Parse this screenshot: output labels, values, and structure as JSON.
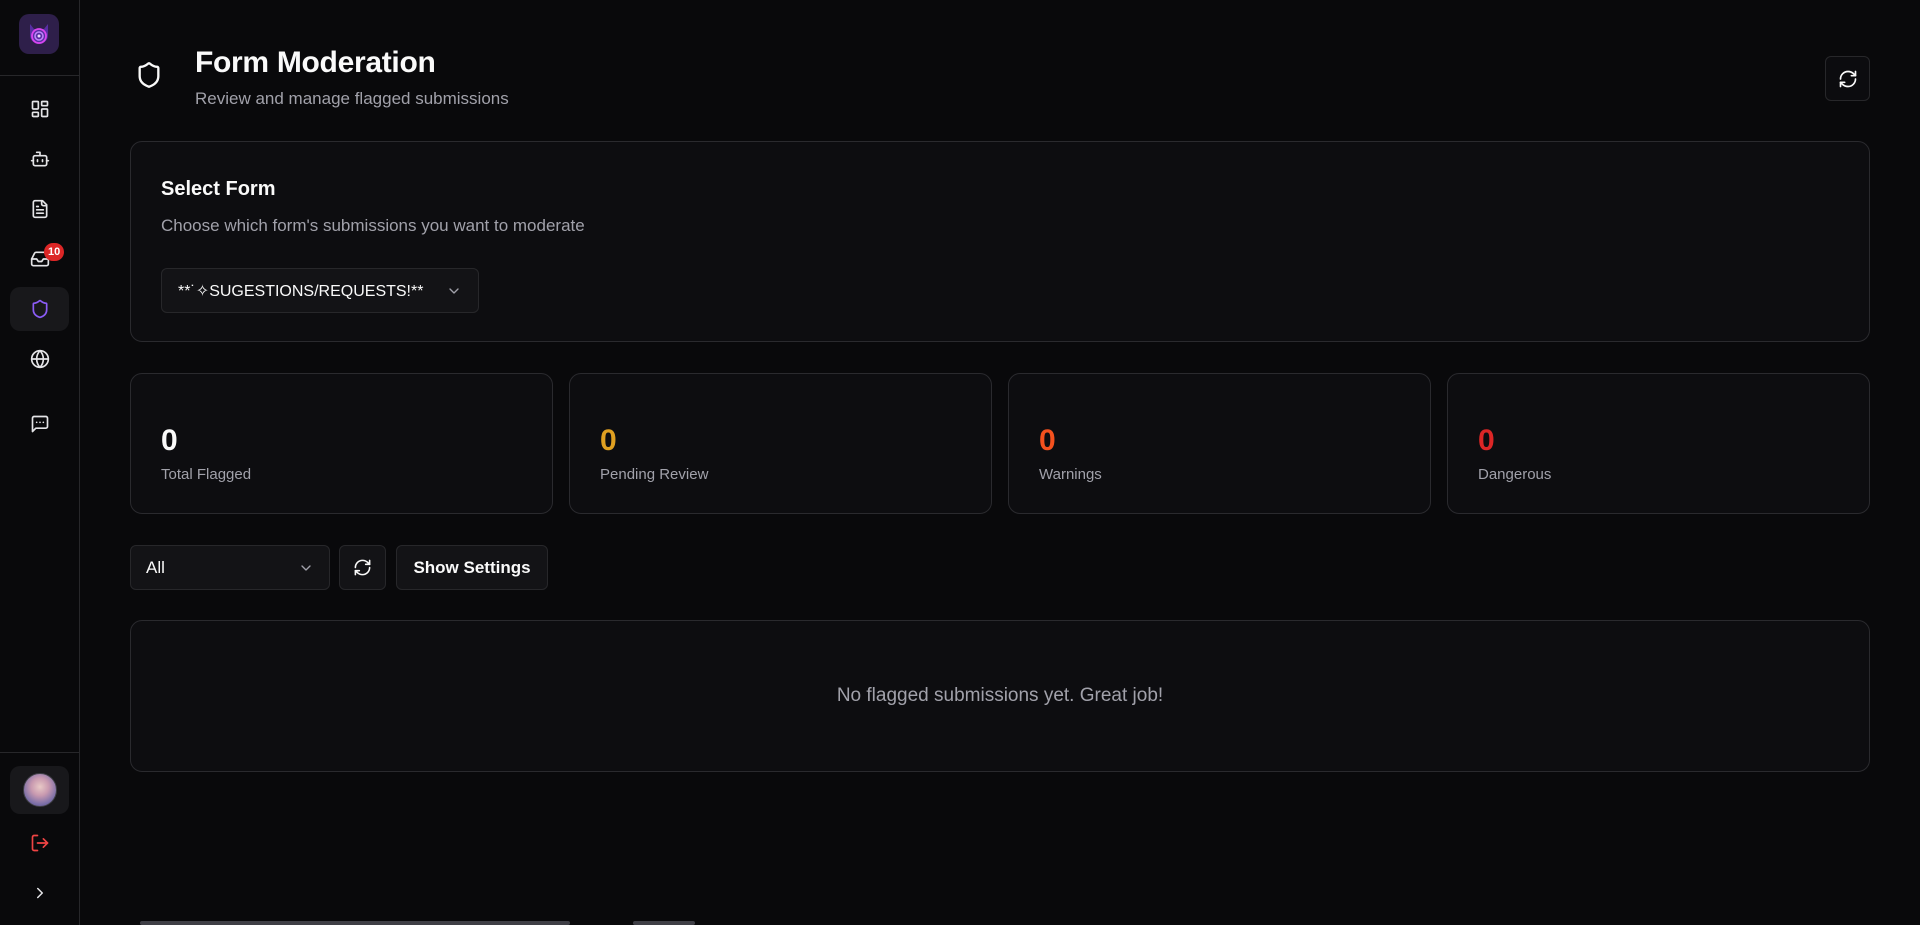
{
  "sidebar": {
    "logo": "cat-spiral-logo",
    "nav_items": [
      {
        "name": "dashboard",
        "icon": "grid-icon"
      },
      {
        "name": "bot",
        "icon": "bot-icon"
      },
      {
        "name": "forms",
        "icon": "document-icon"
      },
      {
        "name": "inbox",
        "icon": "inbox-icon",
        "badge": "10"
      },
      {
        "name": "moderation",
        "icon": "shield-icon",
        "active": true
      },
      {
        "name": "web",
        "icon": "globe-icon"
      },
      {
        "name": "messages",
        "icon": "message-icon"
      }
    ],
    "inbox_badge": "10"
  },
  "header": {
    "title": "Form Moderation",
    "subtitle": "Review and manage flagged submissions"
  },
  "select_form": {
    "title": "Select Form",
    "description": "Choose which form's submissions you want to moderate",
    "selected": "**˙✧SUGESTIONS/REQUESTS!**"
  },
  "stats": [
    {
      "value": "0",
      "label": "Total Flagged",
      "color": "#fafafa"
    },
    {
      "value": "0",
      "label": "Pending Review",
      "color": "#e0a021"
    },
    {
      "value": "0",
      "label": "Warnings",
      "color": "#f4511e"
    },
    {
      "value": "0",
      "label": "Dangerous",
      "color": "#dc2626"
    }
  ],
  "toolbar": {
    "filter_value": "All",
    "settings_label": "Show Settings"
  },
  "empty_state": {
    "message": "No flagged submissions yet. Great job!"
  },
  "colors": {
    "accent": "#8b5cf6",
    "danger": "#dc2626",
    "background": "#09090b"
  }
}
